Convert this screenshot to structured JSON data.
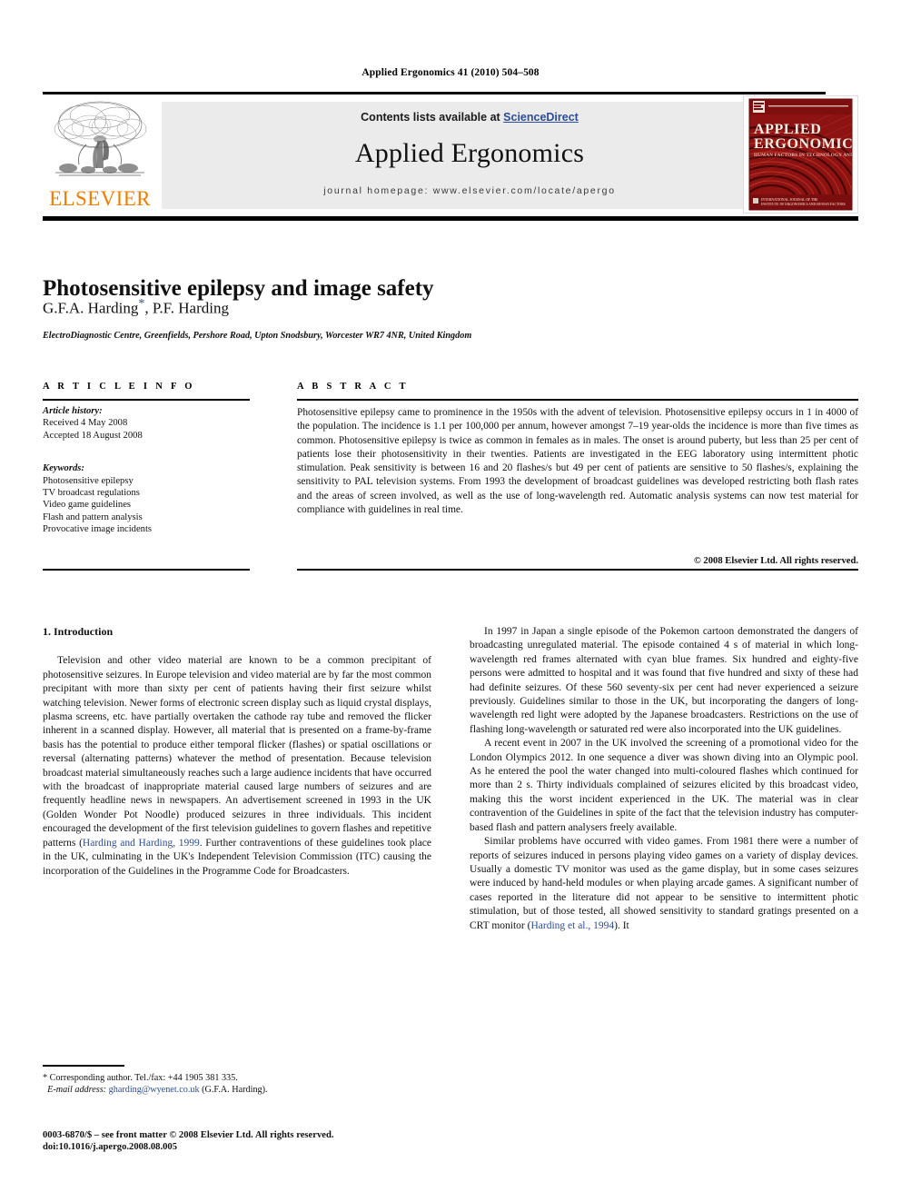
{
  "running_head": "Applied Ergonomics 41 (2010) 504–508",
  "header": {
    "publisher_name": "ELSEVIER",
    "publisher_logo_icon": "elsevier-tree-icon",
    "contents_prefix": "Contents lists available at ",
    "contents_link": "ScienceDirect",
    "journal_title": "Applied Ergonomics",
    "homepage": "journal homepage: www.elsevier.com/locate/apergo",
    "cover": {
      "top_label": "APPLIED",
      "bottom_label": "ERGONOMICS",
      "subtitle": "HUMAN FACTORS IN TECHNOLOGY AND SOCIETY",
      "footer_note": "INTERNATIONAL JOURNAL OF THE INSTITUTE OF ERGONOMICS AND HUMAN FACTORS",
      "brand_color": "#9c1c1c"
    },
    "band_color": "#ebebeb",
    "link_color": "#2b4c9b",
    "brand_orange": "#F07D00"
  },
  "article": {
    "title": "Photosensitive epilepsy and image safety",
    "authors": "G.F.A. Harding",
    "author_star": "*",
    "authors_rest": ", P.F. Harding",
    "affiliation": "ElectroDiagnostic Centre, Greenfields, Pershore Road, Upton Snodsbury, Worcester WR7 4NR, United Kingdom"
  },
  "article_info": {
    "label": "A R T I C L E   I N F O",
    "history_head": "Article history:",
    "history_lines": [
      "Received 4 May 2008",
      "Accepted 18 August 2008"
    ],
    "keywords_head": "Keywords:",
    "keywords": [
      "Photosensitive epilepsy",
      "TV broadcast regulations",
      "Video game guidelines",
      "Flash and pattern analysis",
      "Provocative image incidents"
    ]
  },
  "abstract": {
    "label": "A B S T R A C T",
    "text": "Photosensitive epilepsy came to prominence in the 1950s with the advent of television. Photosensitive epilepsy occurs in 1 in 4000 of the population. The incidence is 1.1 per 100,000 per annum, however amongst 7–19 year-olds the incidence is more than five times as common. Photosensitive epilepsy is twice as common in females as in males. The onset is around puberty, but less than 25 per cent of patients lose their photosensitivity in their twenties. Patients are investigated in the EEG laboratory using intermittent photic stimulation. Peak sensitivity is between 16 and 20 flashes/s but 49 per cent of patients are sensitive to 50 flashes/s, explaining the sensitivity to PAL television systems. From 1993 the development of broadcast guidelines was developed restricting both flash rates and the areas of screen involved, as well as the use of long-wavelength red. Automatic analysis systems can now test material for compliance with guidelines in real time.",
    "copyright": "© 2008 Elsevier Ltd. All rights reserved."
  },
  "body": {
    "section_heading": "1. Introduction",
    "left_paragraphs": [
      "Television and other video material are known to be a common precipitant of photosensitive seizures. In Europe television and video material are by far the most common precipitant with more than sixty per cent of patients having their first seizure whilst watching television. Newer forms of electronic screen display such as liquid crystal displays, plasma screens, etc. have partially overtaken the cathode ray tube and removed the flicker inherent in a scanned display. However, all material that is presented on a frame-by-frame basis has the potential to produce either temporal flicker (flashes) or spatial oscillations or reversal (alternating patterns) whatever the method of presentation. Because television broadcast material simultaneously reaches such a large audience incidents that have occurred with the broadcast of inappropriate material caused large numbers of seizures and are frequently headline news in newspapers. An advertisement screened in 1993 in the UK (Golden Wonder Pot Noodle) produced seizures in three individuals. This incident encouraged the development of the first television guidelines to govern flashes and repetitive patterns "
    ],
    "left_citation_1": "Harding and Harding, 1999",
    "left_paragraph_tail": ". Further contraventions of these guidelines took place in the UK, culminating in the UK's Independent Television Commission (ITC) causing the incorporation of the Guidelines in the Programme Code for Broadcasters.",
    "right_paragraphs": [
      "In 1997 in Japan a single episode of the Pokemon cartoon demonstrated the dangers of broadcasting unregulated material. The episode contained 4 s of material in which long-wavelength red frames alternated with cyan blue frames. Six hundred and eighty-five persons were admitted to hospital and it was found that five hundred and sixty of these had had definite seizures. Of these 560 seventy-six per cent had never experienced a seizure previously. Guidelines similar to those in the UK, but incorporating the dangers of long-wavelength red light were adopted by the Japanese broadcasters. Restrictions on the use of flashing long-wavelength or saturated red were also incorporated into the UK guidelines.",
      "A recent event in 2007 in the UK involved the screening of a promotional video for the London Olympics 2012. In one sequence a diver was shown diving into an Olympic pool. As he entered the pool the water changed into multi-coloured flashes which continued for more than 2 s. Thirty individuals complained of seizures elicited by this broadcast video, making this the worst incident experienced in the UK. The material was in clear contravention of the Guidelines in spite of the fact that the television industry has computer-based flash and pattern analysers freely available."
    ],
    "right_paragraph_3_head": "Similar problems have occurred with video games. From 1981 there were a number of reports of seizures induced in persons playing video games on a variety of display devices. Usually a domestic TV monitor was used as the game display, but in some cases seizures were induced by hand-held modules or when playing arcade games. A significant number of cases reported in the literature did not appear to be sensitive to intermittent photic stimulation, but of those tested, all showed sensitivity to standard gratings presented on a CRT monitor (",
    "right_citation_1": "Harding et al., 1994",
    "right_paragraph_3_tail": "). It"
  },
  "footnotes": {
    "corresponding": "* Corresponding author. Tel./fax: +44 1905 381 335.",
    "email_label": "E-mail address:",
    "email": "gharding@wyenet.co.uk",
    "email_owner": "(G.F.A. Harding).",
    "issn_line": "0003-6870/$ – see front matter © 2008 Elsevier Ltd. All rights reserved.",
    "doi_line": "doi:10.1016/j.apergo.2008.08.005"
  }
}
